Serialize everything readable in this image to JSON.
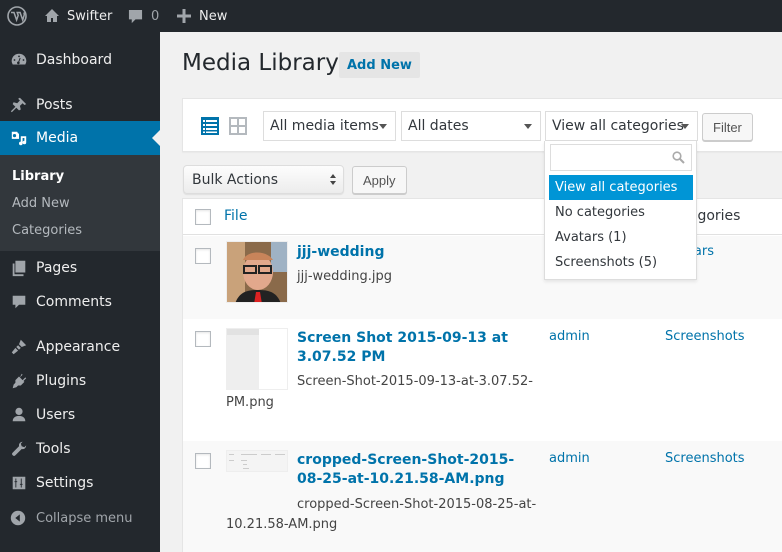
{
  "adminbar": {
    "site_name": "Swifter",
    "comments_count": "0",
    "new_label": "New"
  },
  "sidebar": {
    "items": [
      {
        "label": "Dashboard",
        "icon": "dashboard-icon"
      },
      {
        "label": "Posts",
        "icon": "pin-icon"
      },
      {
        "label": "Media",
        "icon": "media-icon",
        "current": true
      },
      {
        "label": "Pages",
        "icon": "pages-icon"
      },
      {
        "label": "Comments",
        "icon": "comment-icon"
      },
      {
        "label": "Appearance",
        "icon": "paintbrush-icon"
      },
      {
        "label": "Plugins",
        "icon": "plug-icon"
      },
      {
        "label": "Users",
        "icon": "user-icon"
      },
      {
        "label": "Tools",
        "icon": "wrench-icon"
      },
      {
        "label": "Settings",
        "icon": "sliders-icon"
      }
    ],
    "submenu": [
      {
        "label": "Library",
        "active": true
      },
      {
        "label": "Add New"
      },
      {
        "label": "Categories"
      }
    ],
    "collapse_label": "Collapse menu"
  },
  "page": {
    "title": "Media Library",
    "add_new_label": "Add New"
  },
  "filters": {
    "type_value": "All media items",
    "date_value": "All dates",
    "category_value": "View all categories",
    "filter_label": "Filter"
  },
  "category_dropdown": {
    "search_value": "",
    "options": [
      {
        "label": "View all categories",
        "highlighted": true
      },
      {
        "label": "No categories"
      },
      {
        "label": "Avatars (1)"
      },
      {
        "label": "Screenshots (5)"
      }
    ]
  },
  "bulk": {
    "value": "Bulk Actions",
    "apply_label": "Apply"
  },
  "table": {
    "columns": {
      "file": "File",
      "categories": "Categories"
    },
    "rows": [
      {
        "title": "jjj-wedding",
        "filename": "jjj-wedding.jpg",
        "author": "",
        "categories": "Avatars"
      },
      {
        "title": "Screen Shot 2015-09-13 at 3.07.52 PM",
        "filename_line1": "Screen-Shot-2015-09-13-at-3.07.52-",
        "filename_line2": "PM.png",
        "author": "admin",
        "categories": "Screenshots"
      },
      {
        "title": "cropped-Screen-Shot-2015-08-25-at-10.21.58-AM.png",
        "filename_line1": "cropped-Screen-Shot-2015-08-25-at-",
        "filename_line2": "10.21.58-AM.png",
        "author": "admin",
        "categories": "Screenshots"
      }
    ]
  },
  "colors": {
    "accent": "#0073aa",
    "adminbar_bg": "#23282d",
    "highlight": "#0095d6"
  }
}
